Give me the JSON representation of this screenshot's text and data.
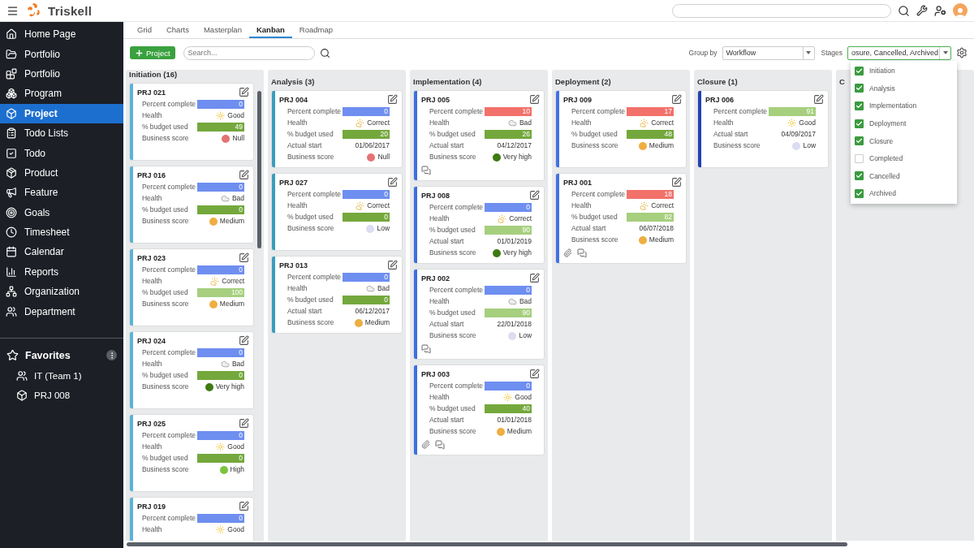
{
  "topbar": {
    "brand": "Triskell"
  },
  "sidebar": {
    "items": [
      {
        "label": "Home Page",
        "selected": false
      },
      {
        "label": "Portfolio",
        "selected": false
      },
      {
        "label": "Portfolio",
        "selected": false
      },
      {
        "label": "Program",
        "selected": false
      },
      {
        "label": "Project",
        "selected": true
      },
      {
        "label": "Todo Lists",
        "selected": false
      },
      {
        "label": "Todo",
        "selected": false
      },
      {
        "label": "Product",
        "selected": false
      },
      {
        "label": "Feature",
        "selected": false
      },
      {
        "label": "Goals",
        "selected": false
      },
      {
        "label": "Timesheet",
        "selected": false
      },
      {
        "label": "Calendar",
        "selected": false
      },
      {
        "label": "Reports",
        "selected": false
      },
      {
        "label": "Organization",
        "selected": false
      },
      {
        "label": "Department",
        "selected": false
      }
    ],
    "favorites": {
      "title": "Favorites",
      "items": [
        {
          "label": "IT (Team 1)",
          "kind": "team"
        },
        {
          "label": "PRJ 008",
          "kind": "project"
        }
      ]
    }
  },
  "tabs": [
    {
      "label": "Grid",
      "selected": false
    },
    {
      "label": "Charts",
      "selected": false
    },
    {
      "label": "Masterplan",
      "selected": false
    },
    {
      "label": "Kanban",
      "selected": true
    },
    {
      "label": "Roadmap",
      "selected": false
    }
  ],
  "toolbar": {
    "add_button": "Project",
    "search": {
      "placeholder": "Search..."
    },
    "group_by": {
      "label": "Group by",
      "value": "Workflow"
    },
    "stages": {
      "label": "Stages",
      "value": "osure, Cancelled, Archived",
      "expanded": true,
      "options": [
        {
          "label": "Initiation",
          "checked": true
        },
        {
          "label": "Analysis",
          "checked": true
        },
        {
          "label": "Implementation",
          "checked": true
        },
        {
          "label": "Deployment",
          "checked": true
        },
        {
          "label": "Closure",
          "checked": true
        },
        {
          "label": "Completed",
          "checked": false
        },
        {
          "label": "Cancelled",
          "checked": true
        },
        {
          "label": "Archived",
          "checked": true
        }
      ]
    }
  },
  "columns": [
    {
      "title": "Initiation (16)",
      "color": "#5ab3d8",
      "scrollable": true,
      "cards": [
        {
          "id": "PRJ 021",
          "attachment": false,
          "comments": false,
          "rows": [
            {
              "kind": "bar",
              "label": "Percent complete",
              "value": "0",
              "color": "#6e8ef0"
            },
            {
              "kind": "sun",
              "label": "Health",
              "value": "Good"
            },
            {
              "kind": "bar",
              "label": "% budget used",
              "value": "49",
              "color": "#74a83c"
            },
            {
              "kind": "score",
              "label": "Business score",
              "value": "Null",
              "color": "#e57373"
            }
          ]
        },
        {
          "id": "PRJ 016",
          "attachment": false,
          "comments": false,
          "rows": [
            {
              "kind": "bar",
              "label": "Percent complete",
              "value": "0",
              "color": "#6e8ef0"
            },
            {
              "kind": "cloud",
              "label": "Health",
              "value": "Bad"
            },
            {
              "kind": "bar",
              "label": "% budget used",
              "value": "0",
              "color": "#74a83c"
            },
            {
              "kind": "score",
              "label": "Business score",
              "value": "Medium",
              "color": "#eeae42"
            }
          ]
        },
        {
          "id": "PRJ 023",
          "attachment": false,
          "comments": false,
          "rows": [
            {
              "kind": "bar",
              "label": "Percent complete",
              "value": "0",
              "color": "#6e8ef0"
            },
            {
              "kind": "partly-cloudy",
              "label": "Health",
              "value": "Correct"
            },
            {
              "kind": "bar",
              "label": "% budget used",
              "value": "100",
              "color": "#a6cf7e"
            },
            {
              "kind": "score",
              "label": "Business score",
              "value": "Medium",
              "color": "#eeae42"
            }
          ]
        },
        {
          "id": "PRJ 024",
          "attachment": false,
          "comments": false,
          "rows": [
            {
              "kind": "bar",
              "label": "Percent complete",
              "value": "0",
              "color": "#6e8ef0"
            },
            {
              "kind": "cloud",
              "label": "Health",
              "value": "Bad"
            },
            {
              "kind": "bar",
              "label": "% budget used",
              "value": "0",
              "color": "#74a83c"
            },
            {
              "kind": "score",
              "label": "Business score",
              "value": "Very high",
              "color": "#3f7a12"
            }
          ]
        },
        {
          "id": "PRJ 025",
          "attachment": false,
          "comments": false,
          "rows": [
            {
              "kind": "bar",
              "label": "Percent complete",
              "value": "0",
              "color": "#6e8ef0"
            },
            {
              "kind": "sun",
              "label": "Health",
              "value": "Good"
            },
            {
              "kind": "bar",
              "label": "% budget used",
              "value": "0",
              "color": "#74a83c"
            },
            {
              "kind": "score",
              "label": "Business score",
              "value": "High",
              "color": "#7cc43e"
            }
          ]
        },
        {
          "id": "PRJ 019",
          "attachment": false,
          "comments": false,
          "rows": [
            {
              "kind": "bar",
              "label": "Percent complete",
              "value": "0",
              "color": "#6e8ef0"
            },
            {
              "kind": "sun",
              "label": "Health",
              "value": "Good"
            }
          ]
        }
      ]
    },
    {
      "title": "Analysis (3)",
      "color": "#3a9cbc",
      "scrollable": false,
      "cards": [
        {
          "id": "PRJ 004",
          "attachment": false,
          "comments": false,
          "rows": [
            {
              "kind": "bar",
              "label": "Percent complete",
              "value": "0",
              "color": "#6e8ef0"
            },
            {
              "kind": "partly-cloudy",
              "label": "Health",
              "value": "Correct"
            },
            {
              "kind": "bar",
              "label": "% budget used",
              "value": "20",
              "color": "#74a83c"
            },
            {
              "kind": "date",
              "label": "Actual start",
              "value": "01/06/2017"
            },
            {
              "kind": "score",
              "label": "Business score",
              "value": "Null",
              "color": "#e57373"
            }
          ]
        },
        {
          "id": "PRJ 027",
          "attachment": false,
          "comments": false,
          "rows": [
            {
              "kind": "bar",
              "label": "Percent complete",
              "value": "0",
              "color": "#6e8ef0"
            },
            {
              "kind": "partly-cloudy",
              "label": "Health",
              "value": "Correct"
            },
            {
              "kind": "bar",
              "label": "% budget used",
              "value": "0",
              "color": "#74a83c"
            },
            {
              "kind": "score",
              "label": "Business score",
              "value": "Low",
              "color": "#dcdcf2"
            }
          ]
        },
        {
          "id": "PRJ 013",
          "attachment": false,
          "comments": false,
          "rows": [
            {
              "kind": "bar",
              "label": "Percent complete",
              "value": "0",
              "color": "#6e8ef0"
            },
            {
              "kind": "cloud",
              "label": "Health",
              "value": "Bad"
            },
            {
              "kind": "bar",
              "label": "% budget used",
              "value": "0",
              "color": "#74a83c"
            },
            {
              "kind": "date",
              "label": "Actual start",
              "value": "06/12/2017"
            },
            {
              "kind": "score",
              "label": "Business score",
              "value": "Medium",
              "color": "#eeae42"
            }
          ]
        }
      ]
    },
    {
      "title": "Implementation (4)",
      "color": "#3d6fe0",
      "scrollable": false,
      "cards": [
        {
          "id": "PRJ 005",
          "attachment": false,
          "comments": true,
          "rows": [
            {
              "kind": "bar",
              "label": "Percent complete",
              "value": "10",
              "color": "#f2716a"
            },
            {
              "kind": "cloud",
              "label": "Health",
              "value": "Bad"
            },
            {
              "kind": "bar",
              "label": "% budget used",
              "value": "26",
              "color": "#74a83c"
            },
            {
              "kind": "date",
              "label": "Actual start",
              "value": "04/12/2017"
            },
            {
              "kind": "score",
              "label": "Business score",
              "value": "Very high",
              "color": "#3f7a12"
            }
          ]
        },
        {
          "id": "PRJ 008",
          "attachment": false,
          "comments": false,
          "rows": [
            {
              "kind": "bar",
              "label": "Percent complete",
              "value": "0",
              "color": "#6e8ef0"
            },
            {
              "kind": "partly-cloudy",
              "label": "Health",
              "value": "Correct"
            },
            {
              "kind": "bar",
              "label": "% budget used",
              "value": "90",
              "color": "#a6cf7e"
            },
            {
              "kind": "date",
              "label": "Actual start",
              "value": "01/01/2019"
            },
            {
              "kind": "score",
              "label": "Business score",
              "value": "Very high",
              "color": "#3f7a12"
            }
          ]
        },
        {
          "id": "PRJ 002",
          "attachment": false,
          "comments": true,
          "rows": [
            {
              "kind": "bar",
              "label": "Percent complete",
              "value": "0",
              "color": "#6e8ef0"
            },
            {
              "kind": "cloud",
              "label": "Health",
              "value": "Bad"
            },
            {
              "kind": "bar",
              "label": "% budget used",
              "value": "90",
              "color": "#a6cf7e"
            },
            {
              "kind": "date",
              "label": "Actual start",
              "value": "22/01/2018"
            },
            {
              "kind": "score",
              "label": "Business score",
              "value": "Low",
              "color": "#dcdcf2"
            }
          ]
        },
        {
          "id": "PRJ 003",
          "attachment": true,
          "comments": true,
          "rows": [
            {
              "kind": "bar",
              "label": "Percent complete",
              "value": "0",
              "color": "#6e8ef0"
            },
            {
              "kind": "sun",
              "label": "Health",
              "value": "Good"
            },
            {
              "kind": "bar",
              "label": "% budget used",
              "value": "40",
              "color": "#74a83c"
            },
            {
              "kind": "date",
              "label": "Actual start",
              "value": "01/01/2018"
            },
            {
              "kind": "score",
              "label": "Business score",
              "value": "Medium",
              "color": "#eeae42"
            }
          ]
        }
      ]
    },
    {
      "title": "Deployment (2)",
      "color": "#4272e2",
      "scrollable": false,
      "cards": [
        {
          "id": "PRJ 009",
          "attachment": false,
          "comments": false,
          "rows": [
            {
              "kind": "bar",
              "label": "Percent complete",
              "value": "17",
              "color": "#f2716a"
            },
            {
              "kind": "partly-cloudy",
              "label": "Health",
              "value": "Correct"
            },
            {
              "kind": "bar",
              "label": "% budget used",
              "value": "48",
              "color": "#74a83c"
            },
            {
              "kind": "score",
              "label": "Business score",
              "value": "Medium",
              "color": "#eeae42"
            }
          ]
        },
        {
          "id": "PRJ 001",
          "attachment": true,
          "comments": true,
          "rows": [
            {
              "kind": "bar",
              "label": "Percent complete",
              "value": "18",
              "color": "#f2716a"
            },
            {
              "kind": "partly-cloudy",
              "label": "Health",
              "value": "Correct"
            },
            {
              "kind": "bar",
              "label": "% budget used",
              "value": "82",
              "color": "#a6cf7e"
            },
            {
              "kind": "date",
              "label": "Actual start",
              "value": "06/07/2018"
            },
            {
              "kind": "score",
              "label": "Business score",
              "value": "Medium",
              "color": "#eeae42"
            }
          ]
        }
      ]
    },
    {
      "title": "Closure (1)",
      "color": "#2541b2",
      "scrollable": false,
      "cards": [
        {
          "id": "PRJ 006",
          "attachment": false,
          "comments": false,
          "rows": [
            {
              "kind": "bar",
              "label": "Percent complete",
              "value": "91",
              "color": "#a6cf7e"
            },
            {
              "kind": "sun",
              "label": "Health",
              "value": "Good"
            },
            {
              "kind": "date",
              "label": "Actual start",
              "value": "04/09/2017"
            },
            {
              "kind": "score",
              "label": "Business score",
              "value": "Low",
              "color": "#dcdcf2"
            }
          ]
        }
      ]
    },
    {
      "title": "C",
      "scrollable": false
    }
  ]
}
